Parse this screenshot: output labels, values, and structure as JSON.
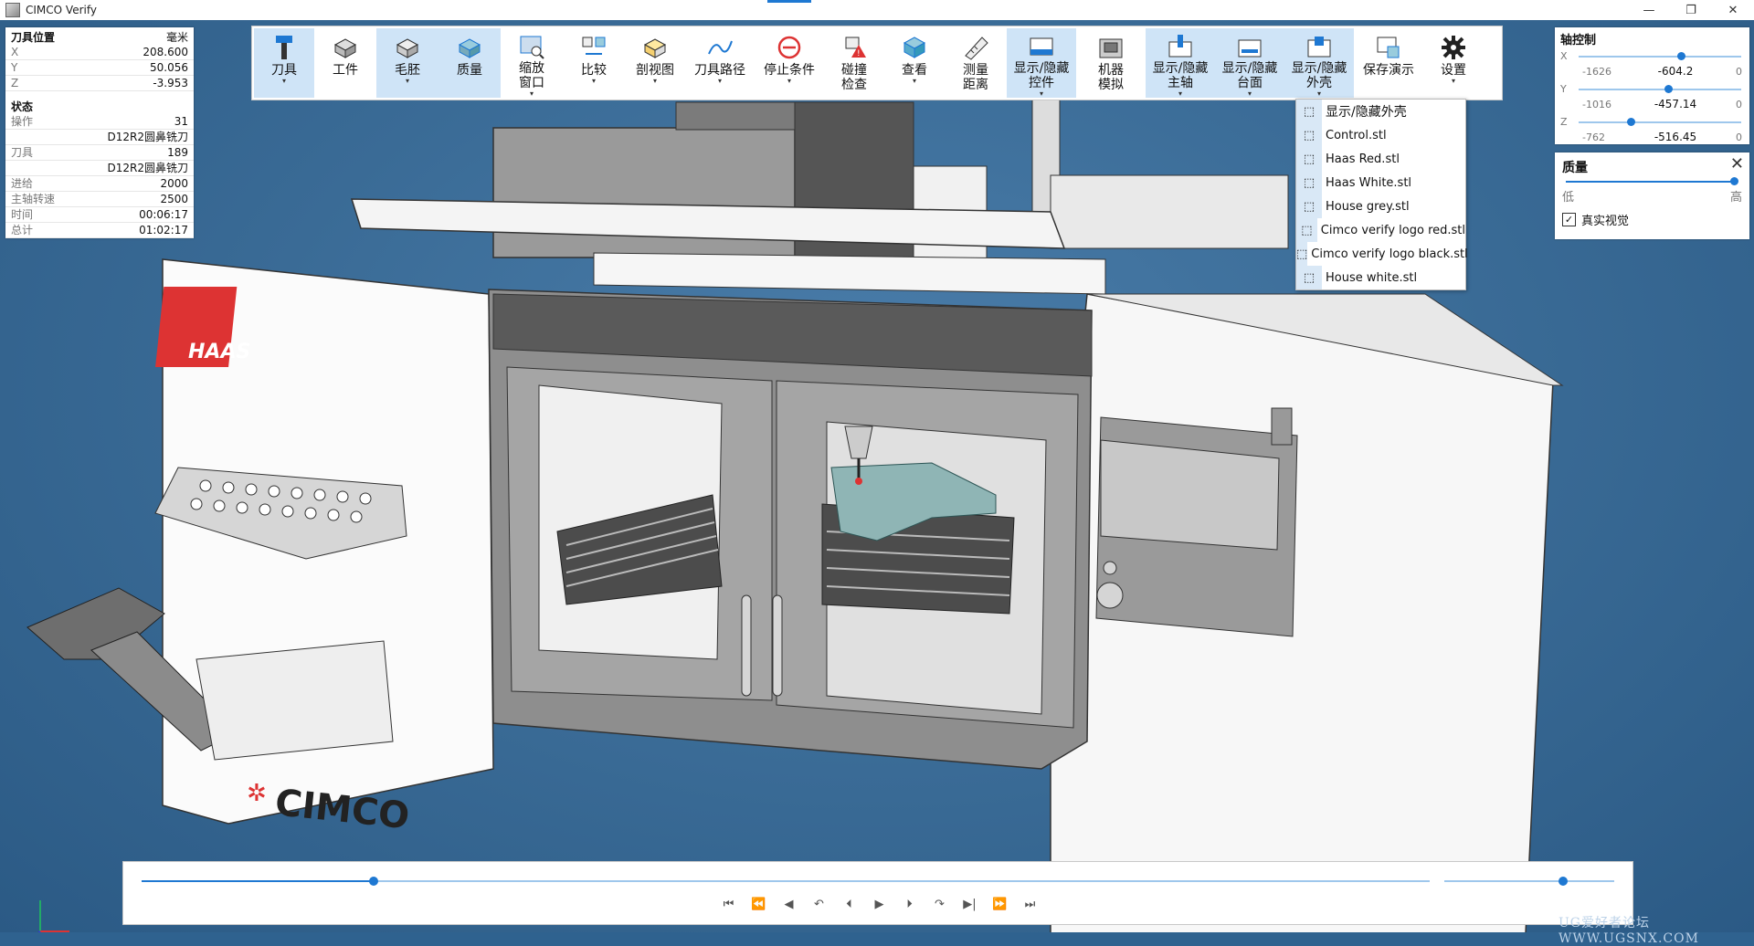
{
  "window": {
    "title": "CIMCO Verify",
    "controls": [
      "—",
      "❐",
      "✕"
    ]
  },
  "info_panel": {
    "tool_position": {
      "title": "刀具位置",
      "unit": "毫米",
      "rows": [
        {
          "label": "X",
          "value": "208.600"
        },
        {
          "label": "Y",
          "value": "50.056"
        },
        {
          "label": "Z",
          "value": "-3.953"
        }
      ]
    },
    "status": {
      "title": "状态",
      "operation_label": "操作",
      "operation_value": "31",
      "operation_name": "D12R2圆鼻铣刀",
      "tool_label": "刀具",
      "tool_value": "189",
      "tool_name": "D12R2圆鼻铣刀",
      "feed_label": "进给",
      "feed_value": "2000",
      "spindle_label": "主轴转速",
      "spindle_value": "2500",
      "time_label": "时间",
      "time_value": "00:06:17",
      "total_label": "总计",
      "total_value": "01:02:17"
    }
  },
  "toolbar": {
    "buttons": [
      {
        "line1": "刀具",
        "line2": "",
        "caret": true,
        "selected": true,
        "icon": "tool-icon"
      },
      {
        "line1": "工件",
        "line2": "",
        "caret": false,
        "selected": false,
        "icon": "workpiece-icon"
      },
      {
        "line1": "毛胚",
        "line2": "",
        "caret": true,
        "selected": true,
        "icon": "stock-icon"
      },
      {
        "line1": "质量",
        "line2": "",
        "caret": false,
        "selected": true,
        "icon": "quality-icon"
      },
      {
        "line1": "缩放",
        "line2": "窗口",
        "caret": true,
        "selected": false,
        "icon": "zoom-window-icon"
      },
      {
        "line1": "比较",
        "line2": "",
        "caret": true,
        "selected": false,
        "icon": "compare-icon"
      },
      {
        "line1": "剖视图",
        "line2": "",
        "caret": true,
        "selected": false,
        "icon": "section-view-icon"
      },
      {
        "line1": "刀具路径",
        "line2": "",
        "caret": true,
        "selected": false,
        "icon": "toolpath-icon"
      },
      {
        "line1": "停止条件",
        "line2": "",
        "caret": true,
        "selected": false,
        "icon": "stop-condition-icon"
      },
      {
        "line1": "碰撞",
        "line2": "检查",
        "caret": false,
        "selected": false,
        "icon": "collision-check-icon"
      },
      {
        "line1": "查看",
        "line2": "",
        "caret": true,
        "selected": false,
        "icon": "view-icon"
      },
      {
        "line1": "测量",
        "line2": "距离",
        "caret": false,
        "selected": false,
        "icon": "measure-distance-icon"
      },
      {
        "line1": "显示/隐藏",
        "line2": "控件",
        "caret": true,
        "selected": true,
        "icon": "show-hide-controls-icon"
      },
      {
        "line1": "机器",
        "line2": "模拟",
        "caret": false,
        "selected": false,
        "icon": "machine-sim-icon"
      },
      {
        "line1": "显示/隐藏",
        "line2": "主轴",
        "caret": true,
        "selected": true,
        "icon": "show-hide-spindle-icon"
      },
      {
        "line1": "显示/隐藏",
        "line2": "台面",
        "caret": true,
        "selected": true,
        "icon": "show-hide-table-icon"
      },
      {
        "line1": "显示/隐藏",
        "line2": "外壳",
        "caret": true,
        "selected": true,
        "icon": "show-hide-housing-icon"
      },
      {
        "line1": "保存演示",
        "line2": "",
        "caret": false,
        "selected": false,
        "icon": "save-demo-icon"
      },
      {
        "line1": "设置",
        "line2": "",
        "caret": true,
        "selected": false,
        "icon": "gear-icon"
      }
    ]
  },
  "dropdown": {
    "header": "显示/隐藏外壳",
    "items": [
      "Control.stl",
      "Haas Red.stl",
      "Haas White.stl",
      "House grey.stl",
      "Cimco verify logo red.stl",
      "Cimco verify logo black.stl",
      "House white.stl"
    ]
  },
  "axis_control": {
    "title": "轴控制",
    "axes": [
      {
        "name": "X",
        "min": "-1626",
        "current": "-604.2",
        "max": "0",
        "fraction": 0.63
      },
      {
        "name": "Y",
        "min": "-1016",
        "current": "-457.14",
        "max": "0",
        "fraction": 0.55
      },
      {
        "name": "Z",
        "min": "-762",
        "current": "-516.45",
        "max": "0",
        "fraction": 0.32
      }
    ]
  },
  "quality": {
    "title": "质量",
    "low": "低",
    "high": "高",
    "fraction": 0.98,
    "realistic_label": "真实视觉",
    "realistic_checked": true,
    "check_mark": "✓",
    "close": "✕"
  },
  "playback": {
    "progress": 0.18,
    "speed": 0.7,
    "controls": [
      "⏮",
      "⏪",
      "◀",
      "↶",
      "⏴",
      "▶",
      "⏵",
      "↷",
      "▶|",
      "⏩",
      "⏭"
    ]
  },
  "watermark": "UG爱好者论坛 WWW.UGSNX.COM",
  "scene": {
    "brand_haas": "HAAS",
    "brand_cimco": "CIMCO"
  }
}
